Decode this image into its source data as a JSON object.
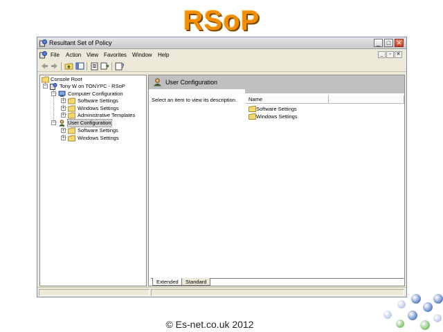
{
  "slide": {
    "title": "RSoP",
    "footer": "© Es-net.co.uk 2012"
  },
  "window": {
    "title": "Resultant Set of Policy",
    "controls": {
      "minimize": "_",
      "maximize": "□",
      "close": "✕"
    }
  },
  "menubar": {
    "items": [
      "File",
      "Action",
      "View",
      "Favorites",
      "Window",
      "Help"
    ],
    "mdi_controls": {
      "minimize": "_",
      "restore": "▫",
      "close": "✕"
    }
  },
  "toolbar": {
    "buttons": [
      "back-icon",
      "forward-icon",
      "up-folder-icon",
      "show-hide-tree-icon",
      "properties-icon",
      "export-list-icon",
      "help-icon"
    ]
  },
  "tree": {
    "console_root": "Console Root",
    "rsop_node": "Tony W on TONYPC - RSoP",
    "computer_configuration": "Computer Configuration",
    "computer_children": [
      "Software Settings",
      "Windows Settings",
      "Administrative Templates"
    ],
    "user_configuration": "User Configuration",
    "user_children": [
      "Software Settings",
      "Windows Settings"
    ],
    "expander_plus": "+",
    "expander_minus": "−"
  },
  "details": {
    "header_title": "User Configuration",
    "description": "Select an item to view its description.",
    "columns": [
      "Name",
      ""
    ],
    "items": [
      "Software Settings",
      "Windows Settings"
    ]
  },
  "tabs": [
    "Extended",
    "Standard"
  ],
  "colors": {
    "title_orange": "#f28c00",
    "folder_yellow": "#f5d76e",
    "header_gray": "#c0c0c0"
  }
}
